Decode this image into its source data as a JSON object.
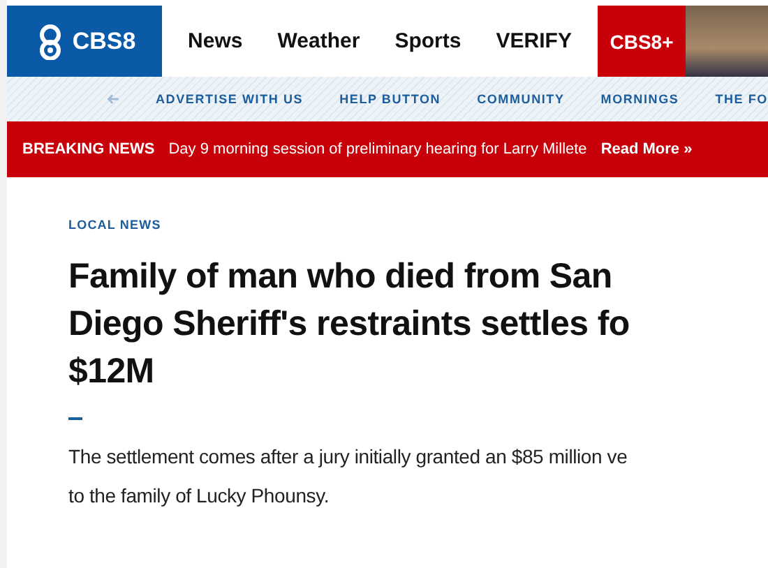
{
  "header": {
    "logo": "CBS8",
    "nav": [
      "News",
      "Weather",
      "Sports",
      "VERIFY"
    ],
    "plus_logo": "CBS8+"
  },
  "subnav": {
    "items": [
      "ADVERTISE WITH US",
      "HELP BUTTON",
      "COMMUNITY",
      "MORNINGS",
      "THE FO"
    ]
  },
  "breaking": {
    "label": "BREAKING NEWS",
    "text": "Day 9 morning session of preliminary hearing for Larry Millete",
    "link": "Read More »"
  },
  "article": {
    "category": "LOCAL NEWS",
    "headline": [
      "Family of man who died from San",
      "Diego Sheriff's restraints settles fo",
      "$12M"
    ],
    "summary": [
      "The settlement comes after a jury initially granted an $85 million ve",
      "to the family of Lucky Phounsy."
    ]
  }
}
